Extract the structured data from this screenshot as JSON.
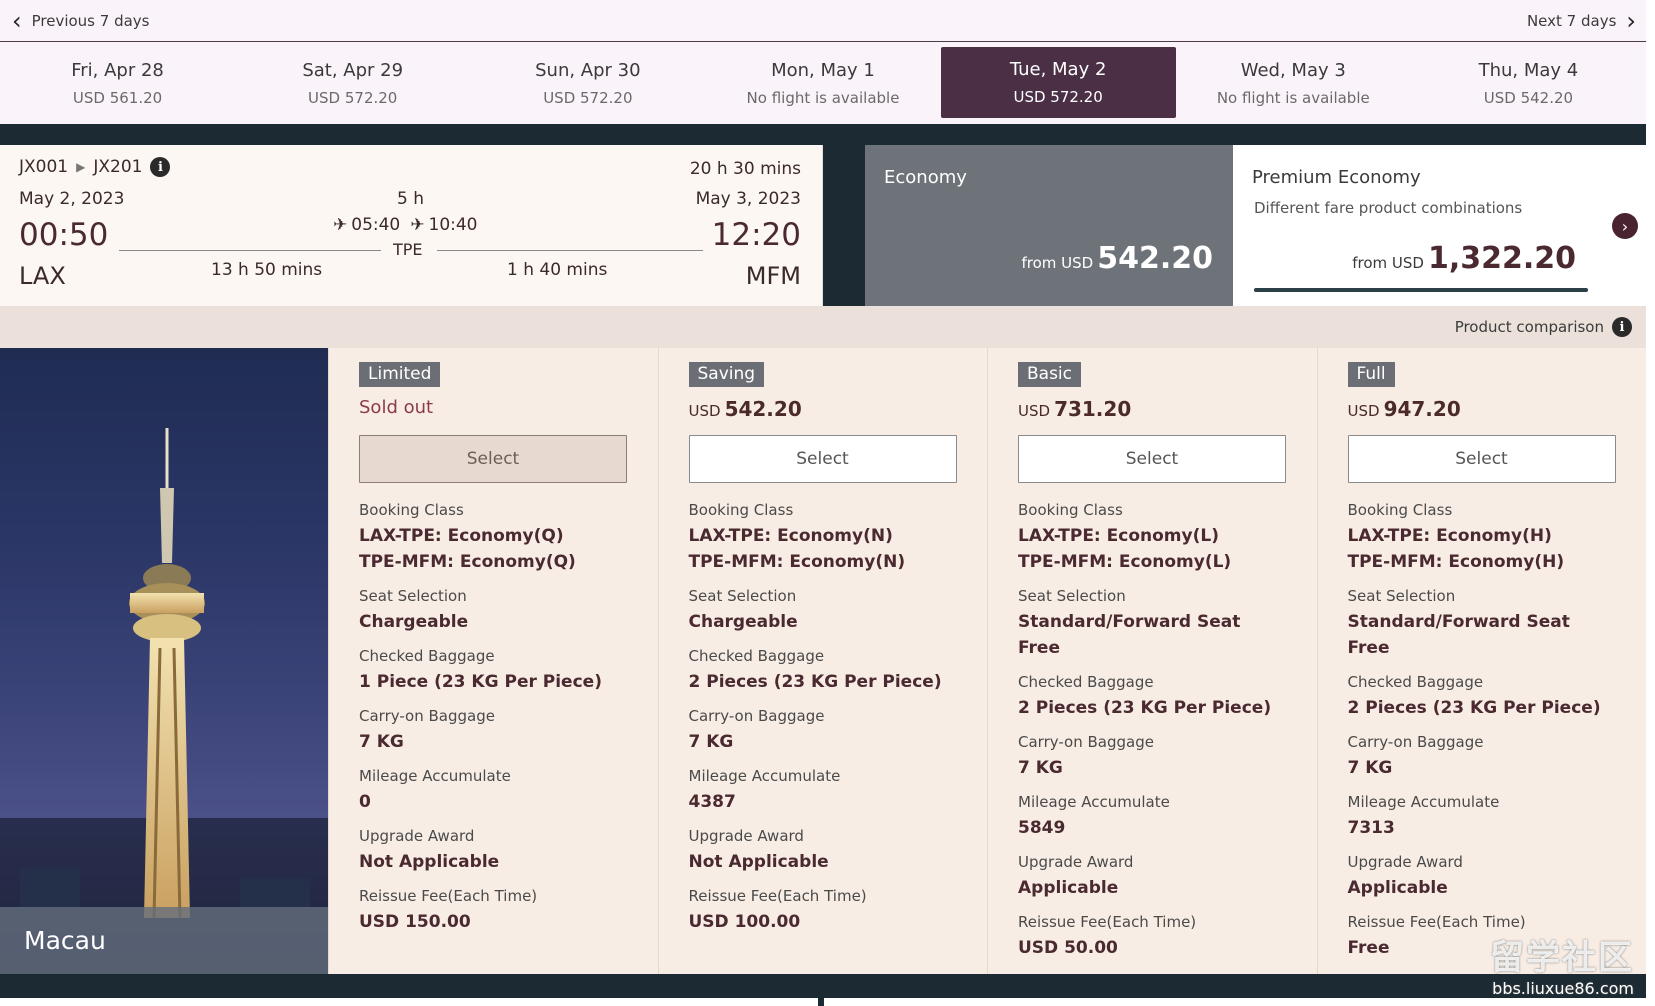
{
  "nav": {
    "prev": "Previous 7 days",
    "next": "Next 7 days"
  },
  "dates": [
    {
      "day": "Fri, Apr 28",
      "price": "USD 561.20",
      "active": false
    },
    {
      "day": "Sat, Apr 29",
      "price": "USD 572.20",
      "active": false
    },
    {
      "day": "Sun, Apr 30",
      "price": "USD 572.20",
      "active": false
    },
    {
      "day": "Mon, May 1",
      "price": "No flight is available",
      "active": false
    },
    {
      "day": "Tue, May 2",
      "price": "USD 572.20",
      "active": true
    },
    {
      "day": "Wed, May 3",
      "price": "No flight is available",
      "active": false
    },
    {
      "day": "Thu, May 4",
      "price": "USD 542.20",
      "active": false
    }
  ],
  "flight": {
    "flight1": "JX001",
    "flight2": "JX201",
    "total_duration": "20 h 30 mins",
    "dep_date": "May 2, 2023",
    "arr_date": "May 3, 2023",
    "layover": "5 h",
    "layover_arr": "05:40",
    "layover_dep": "10:40",
    "dep_time": "00:50",
    "arr_time": "12:20",
    "origin": "LAX",
    "stop": "TPE",
    "destination": "MFM",
    "leg1_duration": "13 h 50 mins",
    "leg2_duration": "1 h 40 mins"
  },
  "cabins": {
    "economy": {
      "title": "Economy",
      "from": "from USD",
      "amount": "542.20"
    },
    "premium": {
      "title": "Premium Economy",
      "subtitle": "Different fare product combinations",
      "from": "from USD",
      "amount": "1,322.20"
    }
  },
  "comparison_label": "Product comparison",
  "destination_label": "Macau",
  "labels": {
    "booking_class": "Booking Class",
    "seat_selection": "Seat Selection",
    "checked_baggage": "Checked Baggage",
    "carry_on": "Carry-on Baggage",
    "mileage": "Mileage Accumulate",
    "upgrade": "Upgrade Award",
    "reissue": "Reissue Fee(Each Time)",
    "select": "Select"
  },
  "fares": [
    {
      "name": "Limited",
      "status": "Sold out",
      "currency": "",
      "price": "",
      "class1": "LAX-TPE: Economy(Q)",
      "class2": "TPE-MFM: Economy(Q)",
      "seat": "Chargeable",
      "checked": "1 Piece (23 KG Per Piece)",
      "carry": "7 KG",
      "mileage": "0",
      "upgrade": "Not Applicable",
      "reissue": "USD 150.00"
    },
    {
      "name": "Saving",
      "status": "",
      "currency": "USD",
      "price": "542.20",
      "class1": "LAX-TPE: Economy(N)",
      "class2": "TPE-MFM: Economy(N)",
      "seat": "Chargeable",
      "checked": "2 Pieces (23 KG Per Piece)",
      "carry": "7 KG",
      "mileage": "4387",
      "upgrade": "Not Applicable",
      "reissue": "USD 100.00"
    },
    {
      "name": "Basic",
      "status": "",
      "currency": "USD",
      "price": "731.20",
      "class1": "LAX-TPE: Economy(L)",
      "class2": "TPE-MFM: Economy(L)",
      "seat": "Standard/Forward Seat Free",
      "checked": "2 Pieces (23 KG Per Piece)",
      "carry": "7 KG",
      "mileage": "5849",
      "upgrade": "Applicable",
      "reissue": "USD 50.00"
    },
    {
      "name": "Full",
      "status": "",
      "currency": "USD",
      "price": "947.20",
      "class1": "LAX-TPE: Economy(H)",
      "class2": "TPE-MFM: Economy(H)",
      "seat": "Standard/Forward Seat Free",
      "checked": "2 Pieces (23 KG Per Piece)",
      "carry": "7 KG",
      "mileage": "7313",
      "upgrade": "Applicable",
      "reissue": "Free"
    }
  ],
  "watermark": {
    "logo": "留学社区",
    "url": "bbs.liuxue86.com"
  },
  "colors": {
    "accent": "#4a2f45",
    "economy_bg": "#6e737a",
    "fare_bg": "#f8ede4"
  }
}
